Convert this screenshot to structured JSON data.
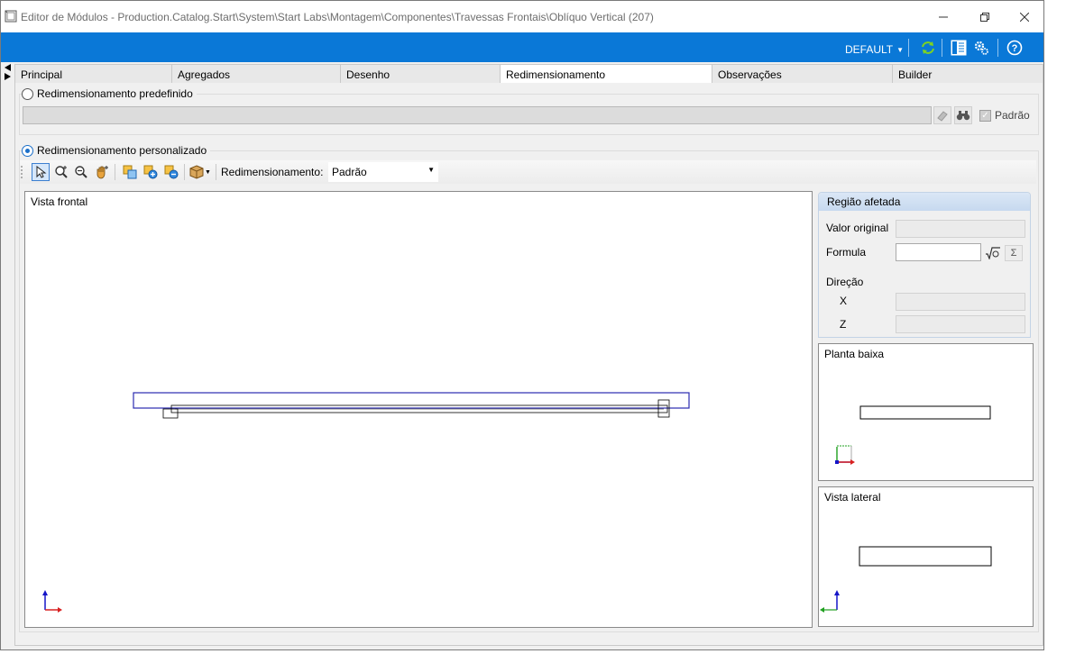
{
  "window": {
    "title": "Editor de Módulos - Production.Catalog.Start\\System\\Start Labs\\Montagem\\Componentes\\Travessas Frontais\\Oblíquo Vertical (207)"
  },
  "toolbar_top": {
    "profile": "DEFAULT"
  },
  "tabs": [
    {
      "label": "Principal"
    },
    {
      "label": "Agregados"
    },
    {
      "label": "Desenho"
    },
    {
      "label": "Redimensionamento"
    },
    {
      "label": "Observações"
    },
    {
      "label": "Builder"
    }
  ],
  "active_tab": "Redimensionamento",
  "predefined": {
    "label": "Redimensionamento predefinido",
    "selected": false,
    "value": "",
    "default_checkbox_label": "Padrão",
    "default_checked": true
  },
  "custom": {
    "label": "Redimensionamento personalizado",
    "selected": true,
    "resize_label": "Redimensionamento:",
    "resize_value": "Padrão"
  },
  "views": {
    "front": "Vista frontal",
    "plan": "Planta baixa",
    "side": "Vista lateral"
  },
  "region": {
    "title": "Região afetada",
    "original_value_label": "Valor original",
    "original_value": "",
    "formula_label": "Formula",
    "formula_value": "",
    "direction_label": "Direção",
    "x_label": "X",
    "x_value": "",
    "z_label": "Z",
    "z_value": ""
  },
  "colors": {
    "accent": "#0a78d7",
    "shape_front": "#2b2bb0"
  }
}
